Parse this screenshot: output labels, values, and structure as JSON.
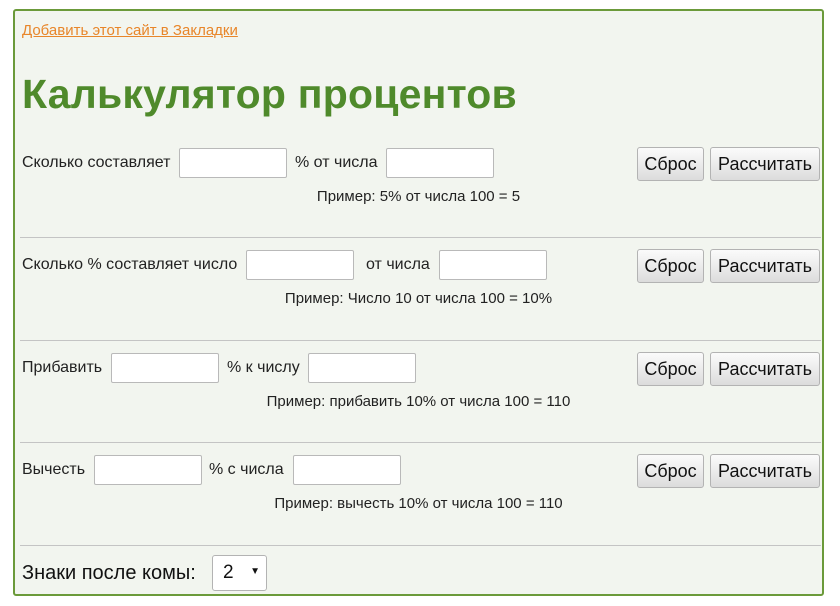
{
  "header": {
    "bookmark_link": "Добавить этот сайт в Закладки",
    "title": "Калькулятор процентов"
  },
  "calculators": [
    {
      "label_before": "Сколько составляет",
      "label_middle": "% от числа",
      "example": "Пример: 5% от числа 100 = 5",
      "reset_label": "Сброс",
      "calc_label": "Рассчитать"
    },
    {
      "label_before": "Сколько % составляет число",
      "label_middle": "от числа",
      "example": "Пример: Число 10 от числа 100 = 10%",
      "reset_label": "Сброс",
      "calc_label": "Рассчитать"
    },
    {
      "label_before": "Прибавить",
      "label_middle": "% к числу",
      "example": "Пример: прибавить 10% от числа 100 = 110",
      "reset_label": "Сброс",
      "calc_label": "Рассчитать"
    },
    {
      "label_before": "Вычесть",
      "label_middle": "% с числа",
      "example": "Пример: вычесть 10% от числа 100 = 110",
      "reset_label": "Сброс",
      "calc_label": "Рассчитать"
    }
  ],
  "decimals": {
    "label": "Знаки после комы:",
    "selected": "2"
  },
  "colors": {
    "title": "#4f8a2b",
    "panel_border": "#6b9a3a",
    "panel_background": "#f2f5ef",
    "link": "#e8862a"
  }
}
